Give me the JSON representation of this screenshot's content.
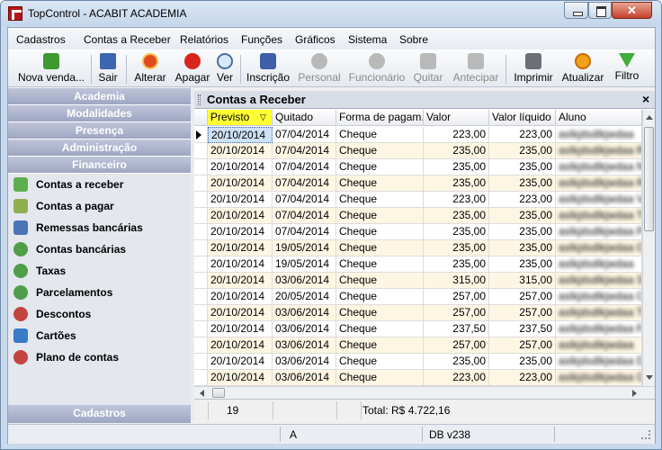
{
  "window": {
    "title": "TopControl - ACABIT ACADEMIA"
  },
  "menubar": {
    "items": [
      {
        "label": "Cadastros"
      },
      {
        "label": "Contas a Receber"
      },
      {
        "label": "Relatórios"
      },
      {
        "label": "Funções"
      },
      {
        "label": "Gráficos"
      },
      {
        "label": "Sistema"
      },
      {
        "label": "Sobre"
      }
    ]
  },
  "toolbar": {
    "nova_venda": "Nova venda...",
    "sair": "Sair",
    "alterar": "Alterar",
    "apagar": "Apagar",
    "ver": "Ver",
    "inscricao": "Inscrição",
    "personal": "Personal",
    "funcionario": "Funcionário",
    "quitar": "Quitar",
    "antecipar": "Antecipar",
    "imprimir": "Imprimir",
    "atualizar": "Atualizar",
    "filtro": "Filtro"
  },
  "sidebar": {
    "sections": [
      "Academia",
      "Modalidades",
      "Presença",
      "Administração",
      "Financeiro"
    ],
    "items": [
      {
        "label": "Contas a receber"
      },
      {
        "label": "Contas a pagar"
      },
      {
        "label": "Remessas bancárias"
      },
      {
        "label": "Contas bancárias"
      },
      {
        "label": "Taxas"
      },
      {
        "label": "Parcelamentos"
      },
      {
        "label": "Descontos"
      },
      {
        "label": "Cartões"
      },
      {
        "label": "Plano de contas"
      }
    ],
    "footer": "Cadastros"
  },
  "panel": {
    "title": "Contas a Receber",
    "close": "×"
  },
  "grid": {
    "columns": [
      "Previsto",
      "Quitado",
      "Forma de pagam...",
      "Valor",
      "Valor líquido",
      "Aluno"
    ],
    "rows": [
      {
        "previsto": "20/10/2014",
        "quitado": "07/04/2014",
        "forma": "Cheque",
        "valor": "223,00",
        "liquido": "223,00",
        "aluno": "aslkjdsdlkjwdaa"
      },
      {
        "previsto": "20/10/2014",
        "quitado": "07/04/2014",
        "forma": "Cheque",
        "valor": "235,00",
        "liquido": "235,00",
        "aluno": "aslkjdsdlkjwdaa RLE"
      },
      {
        "previsto": "20/10/2014",
        "quitado": "07/04/2014",
        "forma": "Cheque",
        "valor": "235,00",
        "liquido": "235,00",
        "aluno": "aslkjdsdlkjwdaa NC"
      },
      {
        "previsto": "20/10/2014",
        "quitado": "07/04/2014",
        "forma": "Cheque",
        "valor": "235,00",
        "liquido": "235,00",
        "aluno": "aslkjdsdlkjwdaa RA"
      },
      {
        "previsto": "20/10/2014",
        "quitado": "07/04/2014",
        "forma": "Cheque",
        "valor": "223,00",
        "liquido": "223,00",
        "aluno": "aslkjdsdlkjwdaa VA"
      },
      {
        "previsto": "20/10/2014",
        "quitado": "07/04/2014",
        "forma": "Cheque",
        "valor": "235,00",
        "liquido": "235,00",
        "aluno": "aslkjdsdlkjwdaa TC"
      },
      {
        "previsto": "20/10/2014",
        "quitado": "07/04/2014",
        "forma": "Cheque",
        "valor": "235,00",
        "liquido": "235,00",
        "aluno": "aslkjdsdlkjwdaa PO"
      },
      {
        "previsto": "20/10/2014",
        "quitado": "19/05/2014",
        "forma": "Cheque",
        "valor": "235,00",
        "liquido": "235,00",
        "aluno": "aslkjdsdlkjwdaa OM"
      },
      {
        "previsto": "20/10/2014",
        "quitado": "19/05/2014",
        "forma": "Cheque",
        "valor": "235,00",
        "liquido": "235,00",
        "aluno": "aslkjdsdlkjwdaa"
      },
      {
        "previsto": "20/10/2014",
        "quitado": "03/06/2014",
        "forma": "Cheque",
        "valor": "315,00",
        "liquido": "315,00",
        "aluno": "aslkjdsdlkjwdaa S L"
      },
      {
        "previsto": "20/10/2014",
        "quitado": "20/05/2014",
        "forma": "Cheque",
        "valor": "257,00",
        "liquido": "257,00",
        "aluno": "aslkjdsdlkjwdaa CU"
      },
      {
        "previsto": "20/10/2014",
        "quitado": "03/06/2014",
        "forma": "Cheque",
        "valor": "257,00",
        "liquido": "257,00",
        "aluno": "aslkjdsdlkjwdaa TE"
      },
      {
        "previsto": "20/10/2014",
        "quitado": "03/06/2014",
        "forma": "Cheque",
        "valor": "237,50",
        "liquido": "237,50",
        "aluno": "aslkjdsdlkjwdaa FAM"
      },
      {
        "previsto": "20/10/2014",
        "quitado": "03/06/2014",
        "forma": "Cheque",
        "valor": "257,00",
        "liquido": "257,00",
        "aluno": "aslkjdsdlkjwdaa"
      },
      {
        "previsto": "20/10/2014",
        "quitado": "03/06/2014",
        "forma": "Cheque",
        "valor": "235,00",
        "liquido": "235,00",
        "aluno": "aslkjdsdlkjwdaa DC"
      },
      {
        "previsto": "20/10/2014",
        "quitado": "03/06/2014",
        "forma": "Cheque",
        "valor": "223,00",
        "liquido": "223,00",
        "aluno": "aslkjdsdlkjwdaa OE"
      }
    ]
  },
  "totals": {
    "count": "19",
    "sum": "Total: R$ 4.722,16"
  },
  "statusbar": {
    "mode": "A",
    "db": "DB v238"
  },
  "colors": {
    "sorted_header": "#ffff33",
    "alt_row": "#fdf6e3",
    "sidebar_header": "#9ea6c3"
  }
}
